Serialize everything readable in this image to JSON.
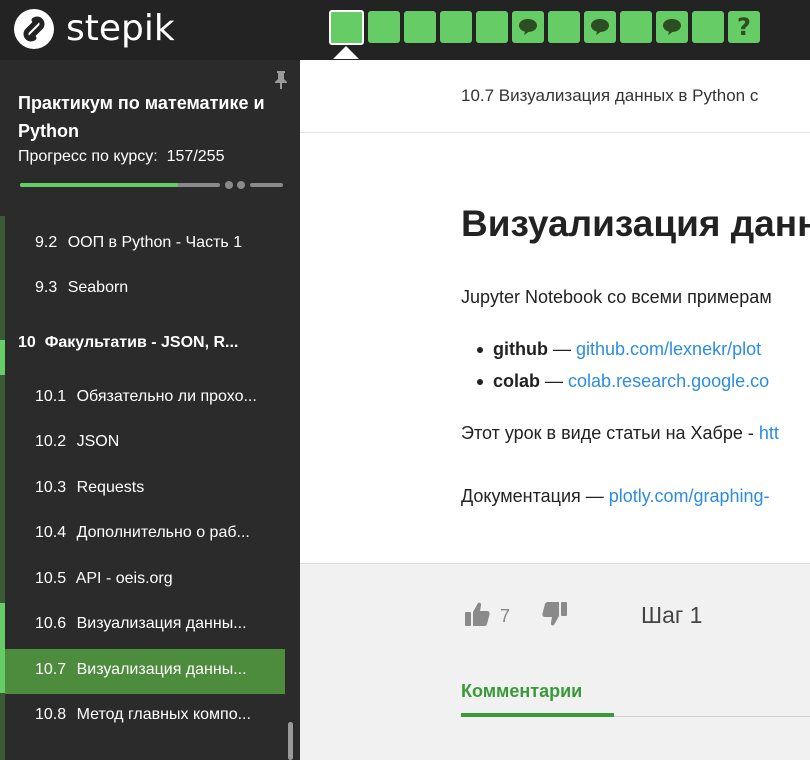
{
  "brand": {
    "name": "stepik"
  },
  "steps": [
    {
      "type": "text",
      "active": true
    },
    {
      "type": "text"
    },
    {
      "type": "text"
    },
    {
      "type": "text"
    },
    {
      "type": "text"
    },
    {
      "type": "comment"
    },
    {
      "type": "text"
    },
    {
      "type": "comment"
    },
    {
      "type": "text"
    },
    {
      "type": "comment"
    },
    {
      "type": "text"
    },
    {
      "type": "quiz",
      "symbol": "?"
    }
  ],
  "sidebar": {
    "course_title": "Практикум по математике и Python",
    "progress_label": "Прогресс по курсу:",
    "progress_value": "157/255",
    "progress_fraction": 0.616,
    "items": [
      {
        "num": "9.2",
        "label": "ООП в Python - Часть 1"
      },
      {
        "num": "9.3",
        "label": "Seaborn"
      },
      {
        "num": "10",
        "label": "Факультатив - JSON, R...",
        "section": true
      },
      {
        "num": "10.1",
        "label": "Обязательно ли прохо..."
      },
      {
        "num": "10.2",
        "label": "JSON"
      },
      {
        "num": "10.3",
        "label": "Requests"
      },
      {
        "num": "10.4",
        "label": "Дополнительно о раб..."
      },
      {
        "num": "10.5",
        "label": "API - oeis.org"
      },
      {
        "num": "10.6",
        "label": "Визуализация данны..."
      },
      {
        "num": "10.7",
        "label": "Визуализация данны...",
        "active": true
      },
      {
        "num": "10.8",
        "label": "Метод главных компо..."
      }
    ]
  },
  "main": {
    "breadcrumb": "10.7 Визуализация данных в Python с",
    "heading": "Визуализация данн",
    "intro": "Jupyter Notebook со всеми примерам",
    "links": [
      {
        "label": "github",
        "sep": " — ",
        "url": "github.com/lexnekr/plot"
      },
      {
        "label": "colab",
        "sep": " — ",
        "url": "colab.research.google.co"
      }
    ],
    "habr_text": "Этот урок в виде статьи на Хабре - ",
    "habr_link": "htt",
    "docs_text": "Документация — ",
    "docs_link": "plotly.com/graphing-",
    "likes": "7",
    "step_label": "Шаг 1",
    "comments_tab": "Комментарии"
  },
  "colors": {
    "accent_green": "#66cc66",
    "link_blue": "#2b8de0",
    "active_item": "#4c8c3c"
  }
}
